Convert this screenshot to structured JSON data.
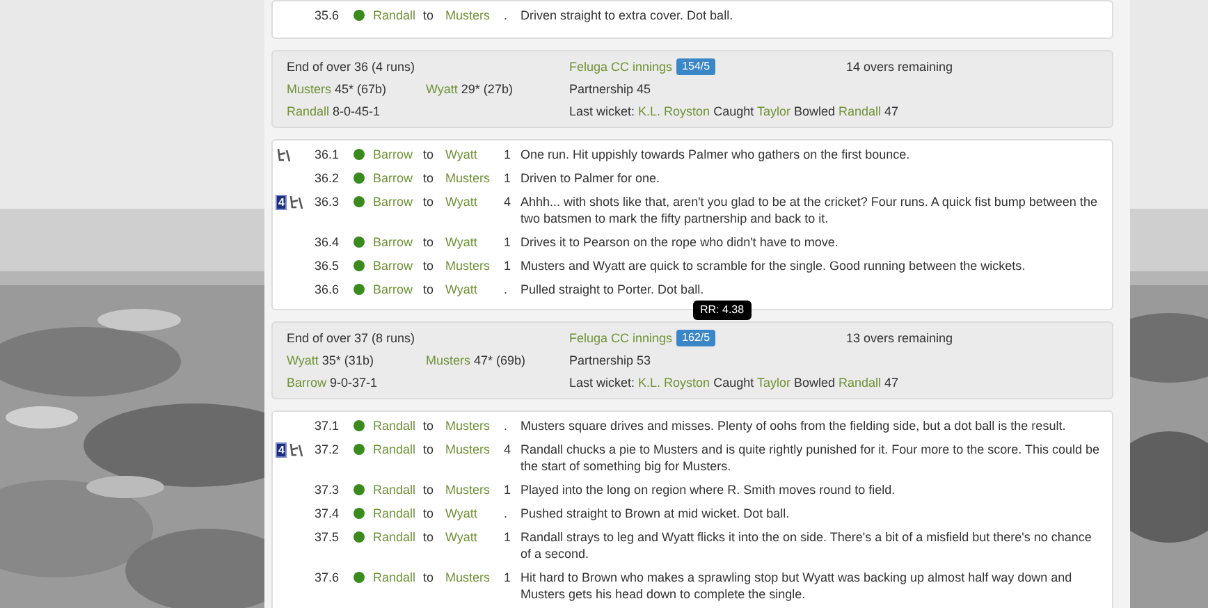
{
  "overs": [
    {
      "balls": [
        {
          "over": "35.6",
          "bowler": "Randall",
          "to": "to",
          "batsman": "Musters",
          "runs": ".",
          "text": "Driven straight to extra cover. Dot ball."
        }
      ],
      "summary": {
        "title": "End of over 36 (4 runs)",
        "batsmen": [
          {
            "name": "Musters",
            "score": "45* (67b)"
          },
          {
            "name": "Wyatt",
            "score": "29* (27b)"
          }
        ],
        "bowler": {
          "name": "Randall",
          "figures": "8-0-45-1"
        },
        "innings": "Feluga CC innings",
        "score": "154/5",
        "partnership": "Partnership 45",
        "last_wicket": {
          "label": "Last wicket:",
          "batsman": "K.L. Royston",
          "how": "Caught",
          "fielder": "Taylor",
          "bowled": "Bowled",
          "bowler": "Randall",
          "score": "47"
        },
        "remaining": "14 overs remaining"
      }
    },
    {
      "balls": [
        {
          "over": "36.1",
          "shot": true,
          "bowler": "Barrow",
          "to": "to",
          "batsman": "Wyatt",
          "runs": "1",
          "text": "One run. Hit uppishly towards Palmer who gathers on the first bounce."
        },
        {
          "over": "36.2",
          "bowler": "Barrow",
          "to": "to",
          "batsman": "Musters",
          "runs": "1",
          "text": "Driven to Palmer for one."
        },
        {
          "over": "36.3",
          "badge": "4",
          "shot": true,
          "bowler": "Barrow",
          "to": "to",
          "batsman": "Wyatt",
          "runs": "4",
          "text": "Ahhh... with shots like that, aren't you glad to be at the cricket? Four runs. A quick fist bump between the two batsmen to mark the fifty partnership and back to it."
        },
        {
          "over": "36.4",
          "bowler": "Barrow",
          "to": "to",
          "batsman": "Wyatt",
          "runs": "1",
          "text": "Drives it to Pearson on the rope who didn't have to move."
        },
        {
          "over": "36.5",
          "bowler": "Barrow",
          "to": "to",
          "batsman": "Musters",
          "runs": "1",
          "text": "Musters and Wyatt are quick to scramble for the single. Good running between the wickets."
        },
        {
          "over": "36.6",
          "bowler": "Barrow",
          "to": "to",
          "batsman": "Wyatt",
          "runs": ".",
          "text": "Pulled straight to Porter. Dot ball."
        }
      ],
      "summary": {
        "title": "End of over 37 (8 runs)",
        "batsmen": [
          {
            "name": "Wyatt",
            "score": "35* (31b)"
          },
          {
            "name": "Musters",
            "score": "47* (69b)"
          }
        ],
        "bowler": {
          "name": "Barrow",
          "figures": "9-0-37-1"
        },
        "innings": "Feluga CC innings",
        "score": "162/5",
        "tooltip": "RR: 4.38",
        "partnership": "Partnership 53",
        "last_wicket": {
          "label": "Last wicket:",
          "batsman": "K.L. Royston",
          "how": "Caught",
          "fielder": "Taylor",
          "bowled": "Bowled",
          "bowler": "Randall",
          "score": "47"
        },
        "remaining": "13 overs remaining"
      }
    },
    {
      "balls": [
        {
          "over": "37.1",
          "bowler": "Randall",
          "to": "to",
          "batsman": "Musters",
          "runs": ".",
          "text": "Musters square drives and misses. Plenty of oohs from the fielding side, but a dot ball is the result."
        },
        {
          "over": "37.2",
          "badge": "4",
          "shot": true,
          "bowler": "Randall",
          "to": "to",
          "batsman": "Musters",
          "runs": "4",
          "text": "Randall chucks a pie to Musters and is quite rightly punished for it. Four more to the score. This could be the start of something big for Musters."
        },
        {
          "over": "37.3",
          "bowler": "Randall",
          "to": "to",
          "batsman": "Musters",
          "runs": "1",
          "text": "Played into the long on region where R. Smith moves round to field."
        },
        {
          "over": "37.4",
          "bowler": "Randall",
          "to": "to",
          "batsman": "Wyatt",
          "runs": ".",
          "text": "Pushed straight to Brown at mid wicket. Dot ball."
        },
        {
          "over": "37.5",
          "bowler": "Randall",
          "to": "to",
          "batsman": "Wyatt",
          "runs": "1",
          "text": "Randall strays to leg and Wyatt flicks it into the on side. There's a bit of a misfield but there's no chance of a second."
        },
        {
          "over": "37.6",
          "bowler": "Randall",
          "to": "to",
          "batsman": "Musters",
          "runs": "1",
          "text": "Hit hard to Brown who makes a sprawling stop but Wyatt was backing up almost half way down and Musters gets his head down to complete the single."
        }
      ]
    }
  ]
}
